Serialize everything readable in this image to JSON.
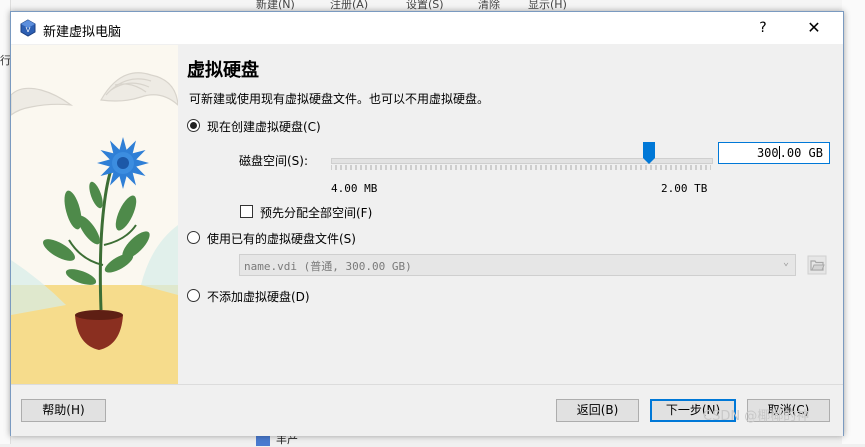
{
  "background": {
    "menu_items": [
      "新建(N)",
      "注册(A)",
      "设置(S)",
      "清除",
      "显示(H)"
    ],
    "left_fragment": "行",
    "bottom_fragment": "丰产"
  },
  "dialog": {
    "title": "新建虚拟电脑",
    "help_label": "?",
    "close_label": "✕",
    "heading": "虚拟硬盘",
    "description": "可新建或使用现有虚拟硬盘文件。也可以不用虚拟硬盘。",
    "options": [
      {
        "label": "现在创建虚拟硬盘(C)",
        "checked": true
      },
      {
        "label": "使用已有的虚拟硬盘文件(S)",
        "checked": false
      },
      {
        "label": "不添加虚拟硬盘(D)",
        "checked": false
      }
    ],
    "disk_size": {
      "label": "磁盘空间(S):",
      "value_before_caret": "300",
      "value_after_caret": ".00 GB",
      "min_label": "4.00 MB",
      "max_label": "2.00 TB"
    },
    "preallocate": {
      "label": "预先分配全部空间(F)",
      "checked": false
    },
    "existing_file": {
      "value": "name.vdi (普通, 300.00 GB)",
      "arrow": "⌄"
    },
    "buttons": {
      "help": "帮助(H)",
      "back": "返回(B)",
      "next": "下一步(N)",
      "cancel": "取消(C)"
    }
  },
  "watermark": "CSDN @椰椰的神",
  "colors": {
    "accent": "#0078d7",
    "leaf": "#4e8a4a",
    "flower": "#2f7fd6",
    "pot": "#8a2f20",
    "sand": "#f5dc8a"
  }
}
